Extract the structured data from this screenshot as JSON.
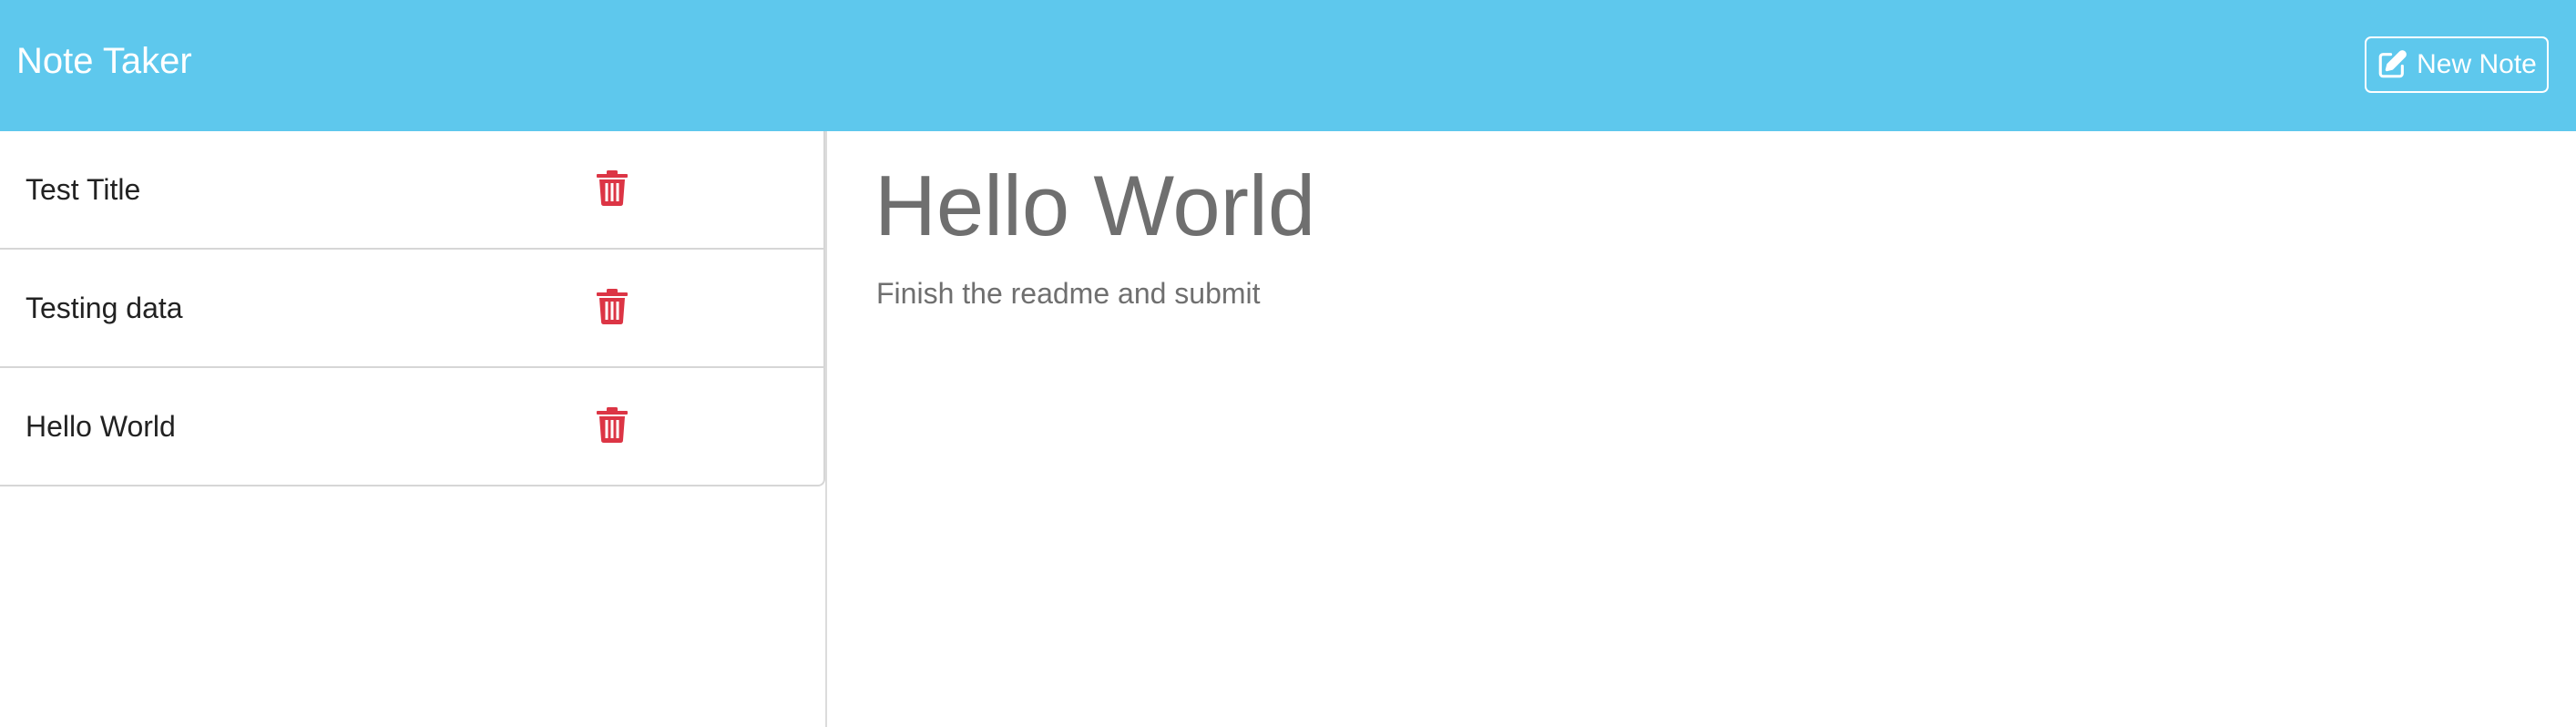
{
  "header": {
    "brand": "Note Taker",
    "new_note_label": "New Note",
    "new_note_icon": "edit-icon",
    "background_color": "#5ec8ed"
  },
  "sidebar": {
    "notes": [
      {
        "title": "Test Title",
        "delete_icon": "trash-icon"
      },
      {
        "title": "Testing data",
        "delete_icon": "trash-icon"
      },
      {
        "title": "Hello World",
        "delete_icon": "trash-icon"
      }
    ],
    "delete_color": "#dc3545"
  },
  "editor": {
    "title": "Hello World",
    "text": "Finish the readme and submit"
  }
}
